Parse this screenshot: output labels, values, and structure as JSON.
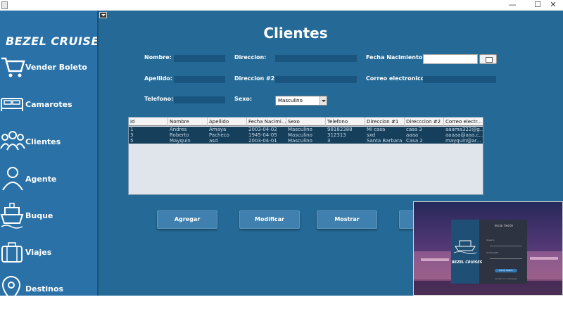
{
  "window": {
    "minimize_label": "—",
    "maximize_label": "☐",
    "close_label": "✕"
  },
  "sidebar": {
    "brand": "BEZEL CRUISES",
    "items": [
      {
        "label": "Vender Boleto",
        "icon": "cart-icon"
      },
      {
        "label": "Camarotes",
        "icon": "bed-icon"
      },
      {
        "label": "Clientes",
        "icon": "users-icon"
      },
      {
        "label": "Agente",
        "icon": "user-icon"
      },
      {
        "label": "Buque",
        "icon": "ship-icon"
      },
      {
        "label": "Viajes",
        "icon": "luggage-icon"
      },
      {
        "label": "Destinos",
        "icon": "location-pin-icon"
      }
    ]
  },
  "main": {
    "title": "Clientes",
    "fields": {
      "nombre": "Nombre:",
      "direccion": "Direccion:",
      "fecha_nacimiento": "Fecha Nacimiento:",
      "apellido": "Apellido:",
      "direccion2": "Direccion #2:",
      "correo": "Correo electronico:",
      "telefono": "Telefono:",
      "sexo": "Sexo:"
    },
    "sexo_value": "Masculino",
    "table": {
      "columns": [
        "Id",
        "Nombre",
        "Apellido",
        "Fecha Nacimi...",
        "Sexo",
        "Telefono",
        "Direccion #1",
        "Direcccion #2",
        "Correo electr..."
      ],
      "rows": [
        [
          "1",
          "Andres",
          "Amaya",
          "2003-04-02",
          "Masculino",
          "98182388",
          "Mi casa",
          "casa 3",
          "aaama322@g..."
        ],
        [
          "3",
          "Roberto",
          "Pacheco",
          "1945-04-05",
          "Masculino",
          "312313",
          "sxd",
          "aaaa",
          "aaaaa@aaa.c..."
        ],
        [
          "5",
          "Mayquin",
          "asd",
          "2003-04-01",
          "Masculino",
          "3",
          "Santa Barbara",
          "Casa 2",
          "mayquin@ar..."
        ]
      ]
    },
    "buttons": {
      "agregar": "Agregar",
      "modificar": "Modificar",
      "mostrar": "Mostrar"
    }
  },
  "login_overlay": {
    "title": "Iniciar Sesión",
    "usuario_label": "Usuario",
    "contrasena_label": "Contraseña",
    "button": "Iniciar Sesión",
    "footer": "Olvidé mi contraseña",
    "brand": "BEZEL CRUISES"
  },
  "colors": {
    "sidebar": "#2a71a8",
    "main": "#256a96",
    "table_selection": "#163f5c"
  }
}
